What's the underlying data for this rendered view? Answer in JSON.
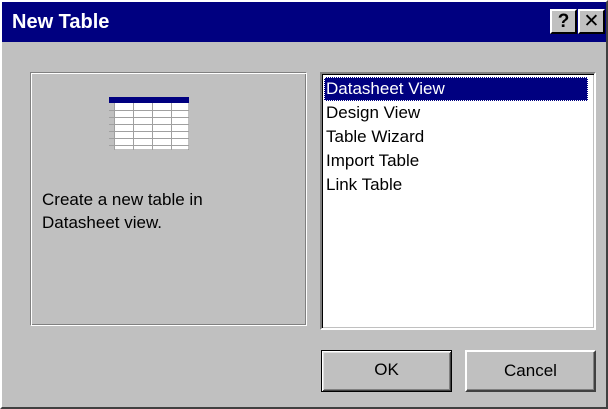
{
  "dialog": {
    "title": "New Table",
    "help_button": "?",
    "close_button": "✕"
  },
  "preview": {
    "icon": "datasheet-table-icon",
    "description": "Create a new table in\nDatasheet view."
  },
  "list": {
    "items": [
      "Datasheet View",
      "Design View",
      "Table Wizard",
      "Import Table",
      "Link Table"
    ],
    "selected": "Datasheet View"
  },
  "buttons": {
    "ok": "OK",
    "cancel": "Cancel"
  },
  "colors": {
    "titlebar": "#000080",
    "face": "#c0c0c0",
    "selection": "#000080"
  }
}
